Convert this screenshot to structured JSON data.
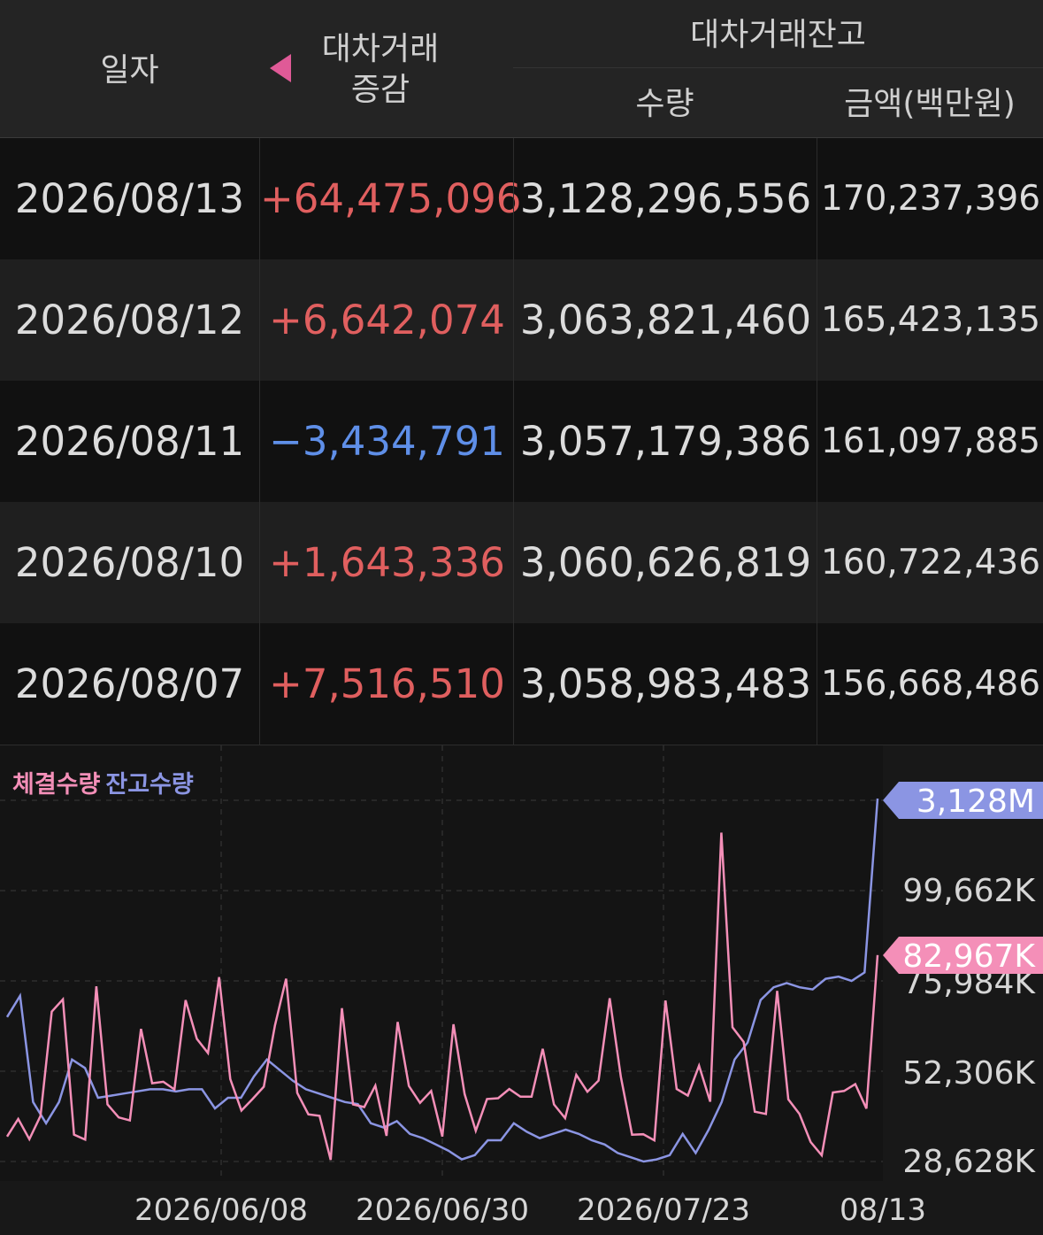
{
  "header": {
    "date": "일자",
    "change_line1": "대차거래",
    "change_line2": "증감",
    "balance": "대차거래잔고",
    "qty": "수량",
    "amount": "금액(백만원)"
  },
  "rows": [
    {
      "date": "2026/08/13",
      "change": "+64,475,096",
      "qty": "3,128,296,556",
      "amount": "170,237,396"
    },
    {
      "date": "2026/08/12",
      "change": "+6,642,074",
      "qty": "3,063,821,460",
      "amount": "165,423,135"
    },
    {
      "date": "2026/08/11",
      "change": "−3,434,791",
      "qty": "3,057,179,386",
      "amount": "161,097,885"
    },
    {
      "date": "2026/08/10",
      "change": "+1,643,336",
      "qty": "3,060,626,819",
      "amount": "160,722,436"
    },
    {
      "date": "2026/08/07",
      "change": "+7,516,510",
      "qty": "3,058,983,483",
      "amount": "156,668,486"
    }
  ],
  "colors": {
    "positive": "#e05f5f",
    "negative": "#5f8fe8",
    "traded": "#f48fb8",
    "balance": "#8b95e3"
  },
  "icons": {
    "collapse": "triangle-left-icon"
  },
  "chart_data": {
    "type": "line",
    "legend": [
      "체결수량",
      "잔고수량"
    ],
    "y_ticks": [
      "99,662K",
      "75,984K",
      "52,306K",
      "28,628K"
    ],
    "x_ticks": [
      "2026/06/08",
      "2026/06/30",
      "2026/07/23",
      "08/13"
    ],
    "badges": {
      "balance": "3,128M",
      "traded": "82,967K"
    },
    "ylim": [
      28628,
      123340
    ],
    "series": [
      {
        "name": "체결수량",
        "values": [
          35600,
          40200,
          34900,
          41000,
          68200,
          71400,
          36100,
          34800,
          74800,
          44000,
          40600,
          39800,
          63700,
          49500,
          49900,
          47900,
          71200,
          61100,
          57400,
          77200,
          50600,
          42400,
          45400,
          48600,
          64600,
          76800,
          47000,
          41400,
          41000,
          29500,
          69100,
          44000,
          43300,
          48900,
          35800,
          65500,
          48800,
          44400,
          47500,
          35600,
          64900,
          46700,
          37100,
          45400,
          45600,
          48000,
          46000,
          46000,
          58500,
          44000,
          40400,
          51700,
          47300,
          50200,
          71700,
          51200,
          36100,
          36200,
          34600,
          71100,
          48000,
          46300,
          54100,
          44700,
          114900,
          64100,
          60300,
          42100,
          41500,
          73600,
          45300,
          41500,
          34200,
          30700,
          47100,
          47500,
          49300,
          42900,
          82967
        ]
      },
      {
        "name": "잔고수량",
        "values": [
          2100000,
          2200000,
          1700000,
          1600000,
          1700000,
          1900000,
          1860000,
          1720000,
          1730000,
          1740000,
          1750000,
          1760000,
          1760000,
          1750000,
          1760000,
          1760000,
          1670000,
          1720000,
          1720000,
          1820000,
          1900000,
          1850000,
          1800000,
          1760000,
          1740000,
          1720000,
          1700000,
          1690000,
          1600000,
          1580000,
          1610000,
          1550000,
          1530000,
          1500000,
          1470000,
          1430000,
          1450000,
          1520000,
          1520000,
          1600000,
          1560000,
          1530000,
          1550000,
          1570000,
          1550000,
          1520000,
          1500000,
          1460000,
          1440000,
          1420000,
          1430000,
          1450000,
          1550000,
          1460000,
          1570000,
          1700000,
          1900000,
          1980000,
          2180000,
          2240000,
          2260000,
          2240000,
          2230000,
          2280000,
          2290000,
          2270000,
          2310000,
          3128000
        ]
      }
    ]
  }
}
